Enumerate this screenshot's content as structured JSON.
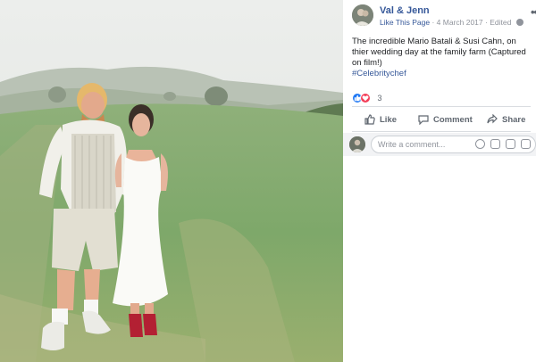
{
  "post": {
    "page_name": "Val & Jenn",
    "like_page": "Like This Page",
    "date": "4 March 2017",
    "edited": "Edited",
    "more": "•••",
    "text": "The incredible Mario Batali & Susi Cahn, on thier wedding day at the family farm (Captured on film!)",
    "hashtag": "#Celebritychef",
    "reaction_count": "3"
  },
  "actions": {
    "like": "Like",
    "comment": "Comment",
    "share": "Share"
  },
  "comment_box": {
    "placeholder": "Write a comment..."
  },
  "icons": {
    "like": "thumbs-up-icon",
    "love": "heart-icon",
    "globe": "globe-icon",
    "comment": "speech-bubble-icon",
    "share": "share-arrow-icon",
    "emoji": "emoji-icon",
    "camera": "camera-icon",
    "gif": "gif-icon",
    "sticker": "sticker-icon"
  },
  "colors": {
    "link_blue": "#365899",
    "like_blue": "#2078f4",
    "love_red": "#f33e58",
    "muted": "#90949c"
  }
}
